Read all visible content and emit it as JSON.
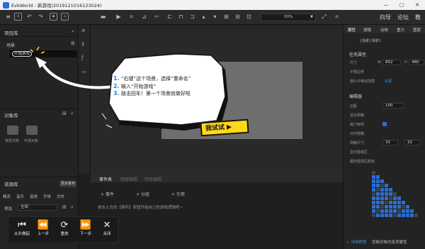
{
  "window": {
    "title": "EvkWorld - 新游戏(20191210161230​24)",
    "minimize_icon": "—",
    "maximize_icon": "▢",
    "close_icon": "✕"
  },
  "toolbar": {
    "zoom": "50%",
    "nav": [
      "向导",
      "论坛",
      "教"
    ]
  },
  "left_panel": {
    "project_title": "项目库",
    "scene_title": "场景",
    "scene_item": "开始游戏",
    "object_title": "对象库",
    "object_items": [
      "我爱对象",
      "可视对象"
    ],
    "resource_title": "资源库",
    "more_button": "更多素材",
    "resource_tabs": [
      "精灵",
      "音乐",
      "音效",
      "字体",
      "文件"
    ],
    "filter_label": "筛选",
    "filter_value": "全部"
  },
  "event_panel": {
    "tabs": [
      "事件表",
      "物理编辑",
      "特效编辑"
    ],
    "buttons": [
      "+ 事件",
      "+ 分组",
      "+ 引用"
    ],
    "hint": "单击上方的【事件】按钮开始自己的游戏逻辑吧~"
  },
  "tutorial": {
    "steps": [
      {
        "num": "1.",
        "text": "“右键”这个场景，选择“重命名”"
      },
      {
        "num": "2.",
        "text": "输入“开始游戏”"
      },
      {
        "num": "3.",
        "text": "敲击回车！第一个场景就做好啦"
      }
    ],
    "try_button": "我试试 ▶"
  },
  "right_panel": {
    "tabs": [
      "属性",
      "滤镜",
      "动效",
      "重力",
      "图层"
    ],
    "section_tag": "[场景]  场景1",
    "sections": [
      "任务属性",
      "编辑器"
    ],
    "labels": [
      "尺寸",
      "不限边界",
      "摄头可移动范围",
      "边距",
      "显示网格",
      "磁力吸附",
      "对齐网格",
      "网格尺寸",
      "显示碰撞区",
      "图形碰撞区颜色"
    ],
    "size_w": "852",
    "size_h": "480",
    "margin": "100",
    "grid_w": "32",
    "grid_h": "32",
    "footer_link": "< 详细教程",
    "footer_text": "控制对象的各类属性"
  },
  "playbar": {
    "buttons": [
      {
        "icon": "⏮",
        "label": "从头做起"
      },
      {
        "icon": "⏪",
        "label": "上一步"
      },
      {
        "icon": "⟳",
        "label": "重放"
      },
      {
        "icon": "⏩",
        "label": "下一步"
      },
      {
        "icon": "✕",
        "label": "关闭"
      }
    ]
  }
}
